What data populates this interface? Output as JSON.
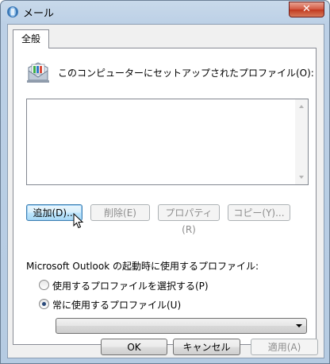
{
  "window": {
    "title": "メール",
    "close_label": "✕"
  },
  "tabs": [
    {
      "label": "全般"
    }
  ],
  "profiles_label": "このコンピューターにセットアップされたプロファイル(O):",
  "buttons": {
    "add": "追加(D)...",
    "delete": "削除(E)",
    "properties": "プロパティ(R)",
    "copy": "コピー(Y)..."
  },
  "outlook_label": "Microsoft Outlook の起動時に使用するプロファイル:",
  "radios": [
    {
      "label": "使用するプロファイルを選択する(P)",
      "selected": false
    },
    {
      "label": "常に使用するプロファイル(U)",
      "selected": true
    }
  ],
  "profile_combo": {
    "value": ""
  },
  "footer": {
    "ok": "OK",
    "cancel": "キャンセル",
    "apply": "適用(A)"
  }
}
